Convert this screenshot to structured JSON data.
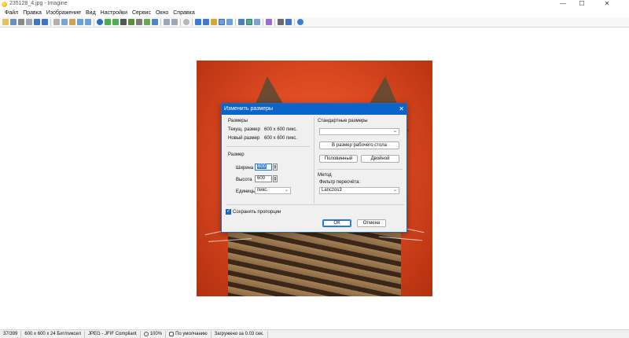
{
  "window": {
    "title": "235128_4.jpg - Imagine",
    "minimize": "—",
    "maximize": "☐",
    "close": "✕"
  },
  "menu": [
    "Файл",
    "Правка",
    "Изображение",
    "Вид",
    "Настройки",
    "Сервис",
    "Окно",
    "Справка"
  ],
  "dialog": {
    "title": "Изменить размеры",
    "close": "✕",
    "sizes_group": "Размеры",
    "current_size_label": "Текущ. размер",
    "current_size_value": "600 x 600 пикс.",
    "new_size_label": "Новый размер",
    "new_size_value": "600 x 600 пикс.",
    "size_group": "Размер",
    "width_label": "Ширина",
    "width_value": "600",
    "height_label": "Высота",
    "height_value": "600",
    "units_label": "Единицы",
    "units_value": "пикс.",
    "keep_proportions_label": "Сохранять пропорции",
    "keep_proportions_checked": true,
    "standard_sizes_group": "Стандартные размеры",
    "standard_sizes_value": "",
    "desktop_size_button": "В размер рабочего стола",
    "half_button": "Половинный",
    "double_button": "Двойной",
    "method_group": "Метод",
    "filter_label": "Фильтр пересчёта:",
    "filter_value": "Lanczos3",
    "ok_button": "ОК",
    "cancel_button": "Отмена"
  },
  "status": {
    "index": "37/399",
    "dimensions": "600 x 600 x 24 Бит/пиксел",
    "format": "JPEG - JFIF Compliant",
    "zoom": "100%",
    "sort": "По умолчанию",
    "load_time": "Загружено за 0.03 сек."
  },
  "colors": {
    "accent": "#0a64c9",
    "photo_background": "#de4a22"
  }
}
